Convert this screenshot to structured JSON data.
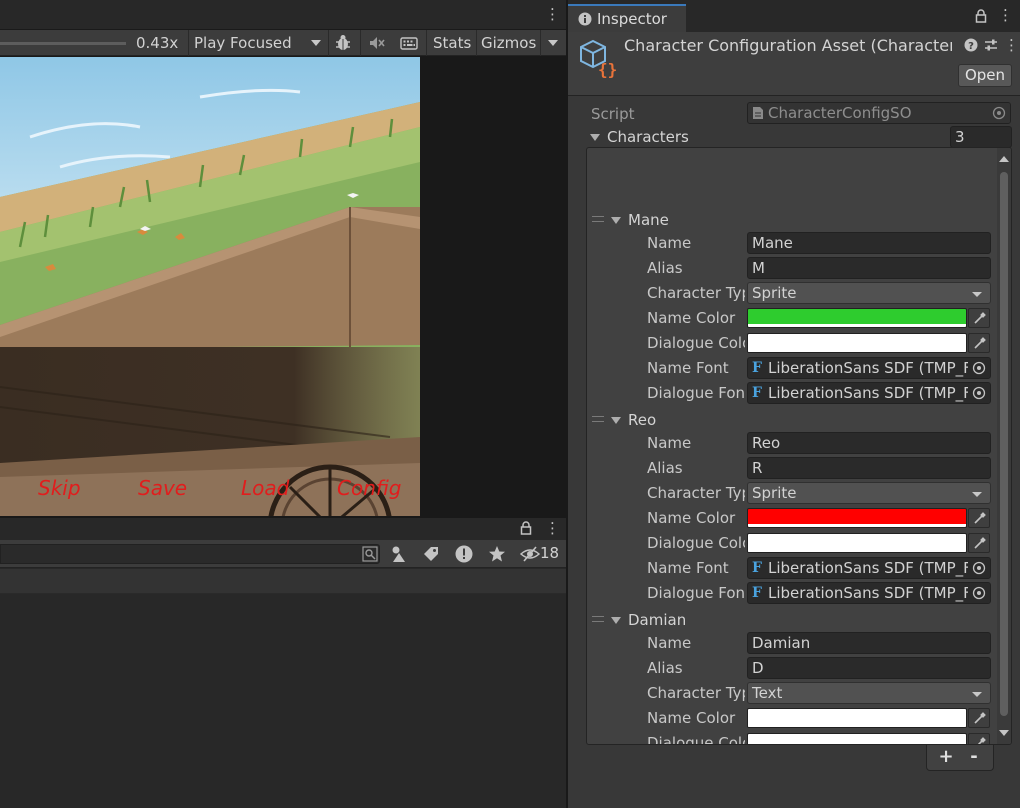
{
  "game_view": {
    "scale_value": "0.43x",
    "play_mode": "Play Focused",
    "stats_label": "Stats",
    "gizmos_label": "Gizmos",
    "buttons": [
      "Skip",
      "Save",
      "Load",
      "Config"
    ],
    "button_color": "#e11d1d"
  },
  "bottom_panel": {
    "hidden_count": "18"
  },
  "inspector": {
    "tab_label": "Inspector",
    "title": "Character Configuration Asset (Character",
    "open_button": "Open",
    "script_label": "Script",
    "script_value": "CharacterConfigSO",
    "list_label": "Characters",
    "list_count": "3",
    "field_labels": {
      "name": "Name",
      "alias": "Alias",
      "character_type": "Character Typ",
      "name_color": "Name Color",
      "dialogue_color": "Dialogue Colo",
      "name_font": "Name Font",
      "dialogue_font": "Dialogue Font"
    },
    "characters": [
      {
        "element_label": "Mane",
        "name": "Mane",
        "alias": "M",
        "character_type": "Sprite",
        "name_color": "#2ecc2e",
        "dialogue_color": "#ffffff",
        "name_font": "LiberationSans SDF (TMP_Fo",
        "dialogue_font": "LiberationSans SDF (TMP_Fo"
      },
      {
        "element_label": "Reo",
        "name": "Reo",
        "alias": "R",
        "character_type": "Sprite",
        "name_color": "#ff0000",
        "dialogue_color": "#ffffff",
        "name_font": "LiberationSans SDF (TMP_Fo",
        "dialogue_font": "LiberationSans SDF (TMP_Fo"
      },
      {
        "element_label": "Damian",
        "name": "Damian",
        "alias": "D",
        "character_type": "Text",
        "name_color": "#ffffff",
        "dialogue_color": "#ffffff",
        "name_font": "LiberationSans SDF (TMP_Fo",
        "dialogue_font": "LiberationSans SDF (TMP_Fo"
      }
    ],
    "add_label": "+",
    "remove_label": "-"
  }
}
